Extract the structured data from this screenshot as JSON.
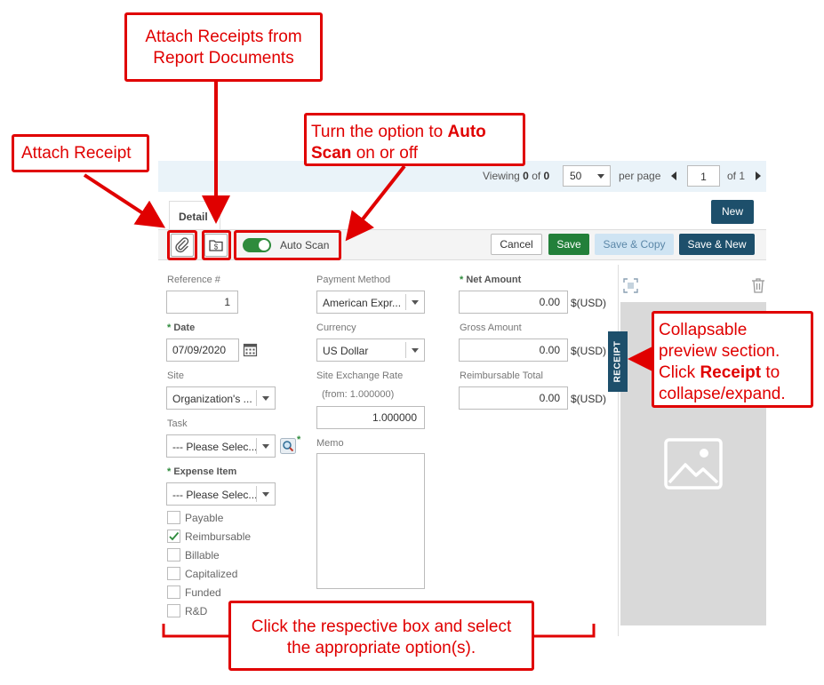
{
  "pager": {
    "viewing": "Viewing",
    "range_start": "0",
    "of_word": "of",
    "range_total": "0",
    "per_page_value": "50",
    "per_page_label": "per page",
    "page_number": "1",
    "of_pages": "of 1"
  },
  "tabs": {
    "detail": "Detail"
  },
  "buttons": {
    "new": "New",
    "cancel": "Cancel",
    "save": "Save",
    "save_copy": "Save & Copy",
    "save_new": "Save & New"
  },
  "toolbar": {
    "auto_scan_label": "Auto Scan",
    "auto_scan_on": true
  },
  "form": {
    "reference": {
      "label": "Reference #",
      "value": "1"
    },
    "date": {
      "label": "Date",
      "value": "07/09/2020"
    },
    "site": {
      "label": "Site",
      "value": "Organization's ..."
    },
    "task": {
      "label": "Task",
      "value": "--- Please Selec..."
    },
    "expense_item": {
      "label": "Expense Item",
      "value": "--- Please Selec..."
    },
    "payment_method": {
      "label": "Payment Method",
      "value": "American Expr..."
    },
    "currency": {
      "label": "Currency",
      "value": "US Dollar"
    },
    "exchange_rate": {
      "label": "Site Exchange Rate",
      "from": "(from: 1.000000)",
      "value": "1.000000"
    },
    "memo": {
      "label": "Memo",
      "value": ""
    },
    "net_amount": {
      "label": "Net Amount",
      "value": "0.00",
      "unit": "$(USD)"
    },
    "gross_amount": {
      "label": "Gross Amount",
      "value": "0.00",
      "unit": "$(USD)"
    },
    "reimbursable_total": {
      "label": "Reimbursable Total",
      "value": "0.00",
      "unit": "$(USD)"
    },
    "checkboxes": [
      {
        "label": "Payable",
        "checked": false
      },
      {
        "label": "Reimbursable",
        "checked": true
      },
      {
        "label": "Billable",
        "checked": false
      },
      {
        "label": "Capitalized",
        "checked": false
      },
      {
        "label": "Funded",
        "checked": false
      },
      {
        "label": "R&D",
        "checked": false
      }
    ]
  },
  "preview": {
    "tab_label": "RECEIPT"
  },
  "annotations": {
    "attach_receipt": "Attach Receipt",
    "attach_from_docs_1": "Attach Receipts from",
    "attach_from_docs_2": "Report Documents",
    "auto_scan_1": "Turn the option to ",
    "auto_scan_bold": "Auto",
    "auto_scan_2_bold": "Scan",
    "auto_scan_2": " on or off",
    "preview_1": "Collapsable",
    "preview_2": "preview section.",
    "preview_3_pre": "Click ",
    "preview_3_bold": "Receipt",
    "preview_3_post": " to",
    "preview_4": "collapse/expand.",
    "checkbox_hint_1": "Click the respective box and select",
    "checkbox_hint_2": "the appropriate option(s)."
  },
  "colors": {
    "annotation_red": "#e00000",
    "primary_dark": "#1d4f6b",
    "save_green": "#23803a",
    "required_star": "#2e8b3c"
  }
}
